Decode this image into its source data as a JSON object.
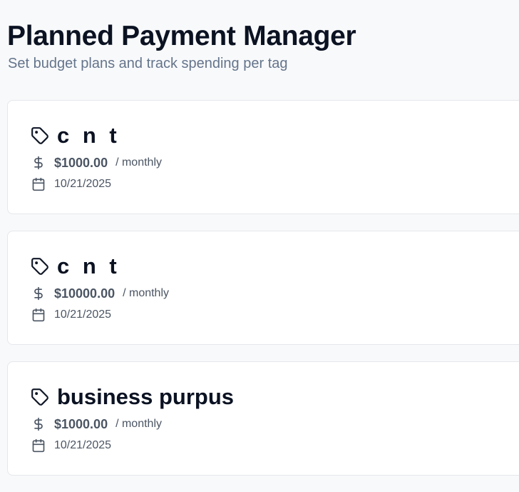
{
  "page": {
    "title": "Planned Payment Manager",
    "subtitle": "Set budget plans and track spending per tag"
  },
  "plans": [
    {
      "tag": "c n t",
      "amount": "$1000.00",
      "period": "/ monthly",
      "date": "10/21/2025"
    },
    {
      "tag": "c n t",
      "amount": "$10000.00",
      "period": "/ monthly",
      "date": "10/21/2025"
    },
    {
      "tag": "business purpus",
      "amount": "$1000.00",
      "period": "/ monthly",
      "date": "10/21/2025"
    }
  ],
  "icons": {
    "tag": "tag-icon",
    "amount": "dollar-sign-icon",
    "date": "calendar-icon"
  },
  "colors": {
    "title": "#0b1222",
    "muted": "#64748b",
    "meta": "#4b5563",
    "card_border": "#e5e7eb",
    "background": "#f8f9fb"
  }
}
